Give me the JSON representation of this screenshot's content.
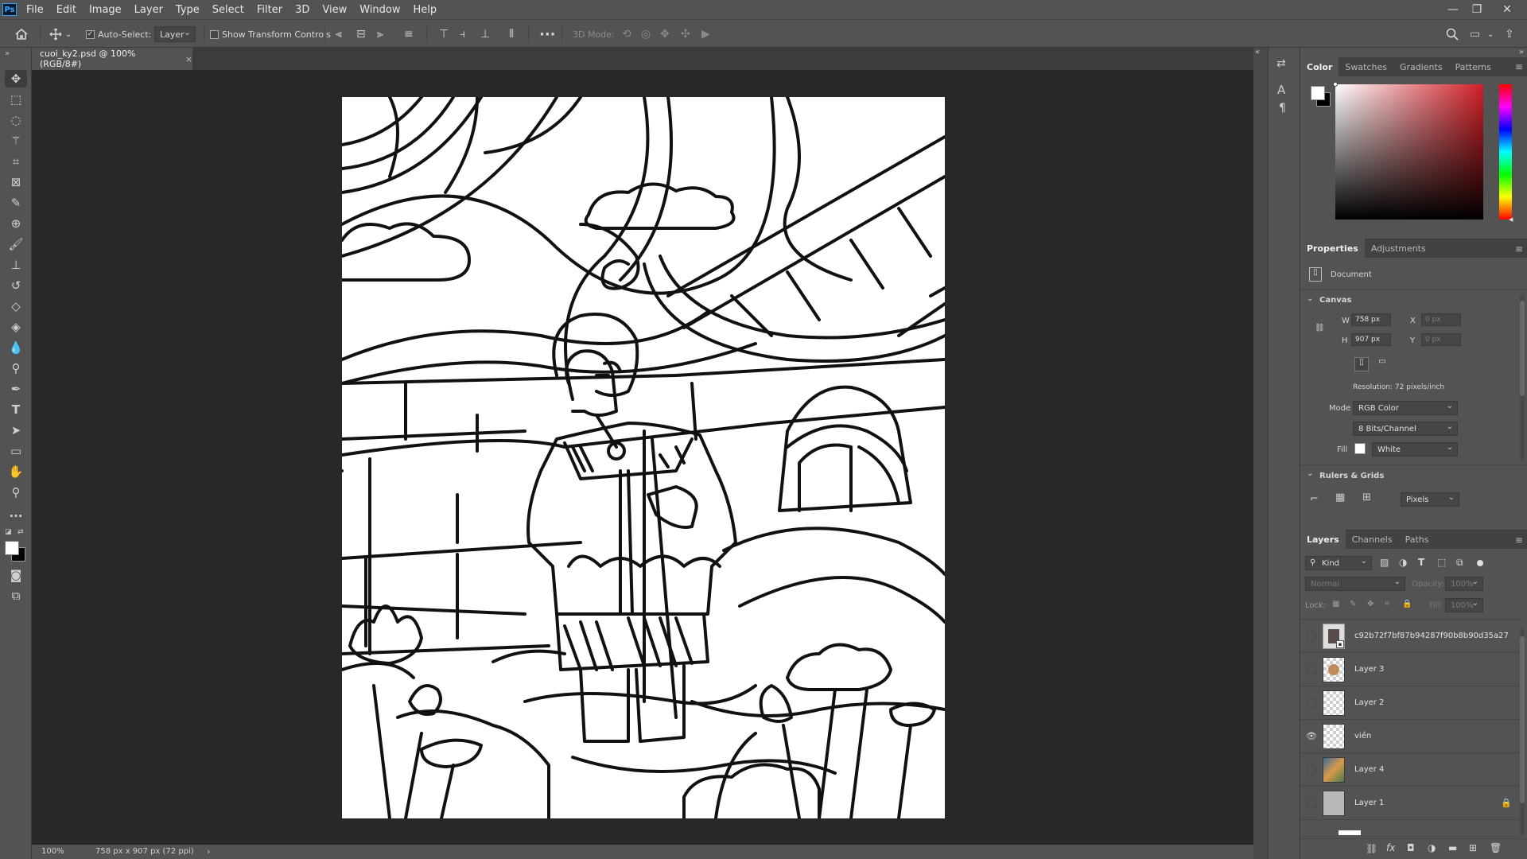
{
  "app": {
    "logo": "Ps"
  },
  "menu": [
    "File",
    "Edit",
    "Image",
    "Layer",
    "Type",
    "Select",
    "Filter",
    "3D",
    "View",
    "Window",
    "Help"
  ],
  "options_bar": {
    "auto_select_label": "Auto-Select:",
    "auto_select_checked": true,
    "auto_select_target": "Layer",
    "show_transform_label": "Show Transform Controls",
    "mode_3d_label": "3D Mode:"
  },
  "document": {
    "tab_title": "cuoi_ky2.psd @ 100% (RGB/8#)",
    "zoom": "100%",
    "status_info": "758 px x 907 px (72 ppi)"
  },
  "color_panel": {
    "tabs": [
      "Color",
      "Swatches",
      "Gradients",
      "Patterns"
    ],
    "active_tab": "Color",
    "hue_color": "#d01f27"
  },
  "properties_panel": {
    "tabs": [
      "Properties",
      "Adjustments"
    ],
    "active_tab": "Properties",
    "type_label": "Document",
    "canvas_section": "Canvas",
    "w_label": "W",
    "w_value": "758 px",
    "h_label": "H",
    "h_value": "907 px",
    "x_label": "X",
    "x_value": "0 px",
    "y_label": "Y",
    "y_value": "0 px",
    "resolution": "Resolution: 72 pixels/inch",
    "mode_label": "Mode",
    "mode_value": "RGB Color",
    "bits_value": "8 Bits/Channel",
    "fill_label": "Fill",
    "fill_value": "White",
    "rulers_section": "Rulers & Grids",
    "units_value": "Pixels"
  },
  "layers_panel": {
    "tabs": [
      "Layers",
      "Channels",
      "Paths"
    ],
    "active_tab": "Layers",
    "filter_kind": "Kind",
    "blend_mode": "Normal",
    "opacity_label": "Opacity:",
    "opacity_value": "100%",
    "lock_label": "Lock:",
    "fill_label": "Fill:",
    "fill_value": "100%",
    "layers": [
      {
        "name": "c92b72f7bf87b94287f90b8b90d35a27",
        "visible": false,
        "locked": false
      },
      {
        "name": "Layer 3",
        "visible": false,
        "locked": false
      },
      {
        "name": "Layer 2",
        "visible": false,
        "locked": false
      },
      {
        "name": "viền",
        "visible": true,
        "locked": false
      },
      {
        "name": "Layer 4",
        "visible": false,
        "locked": false
      },
      {
        "name": "Layer 1",
        "visible": false,
        "locked": true
      }
    ]
  }
}
